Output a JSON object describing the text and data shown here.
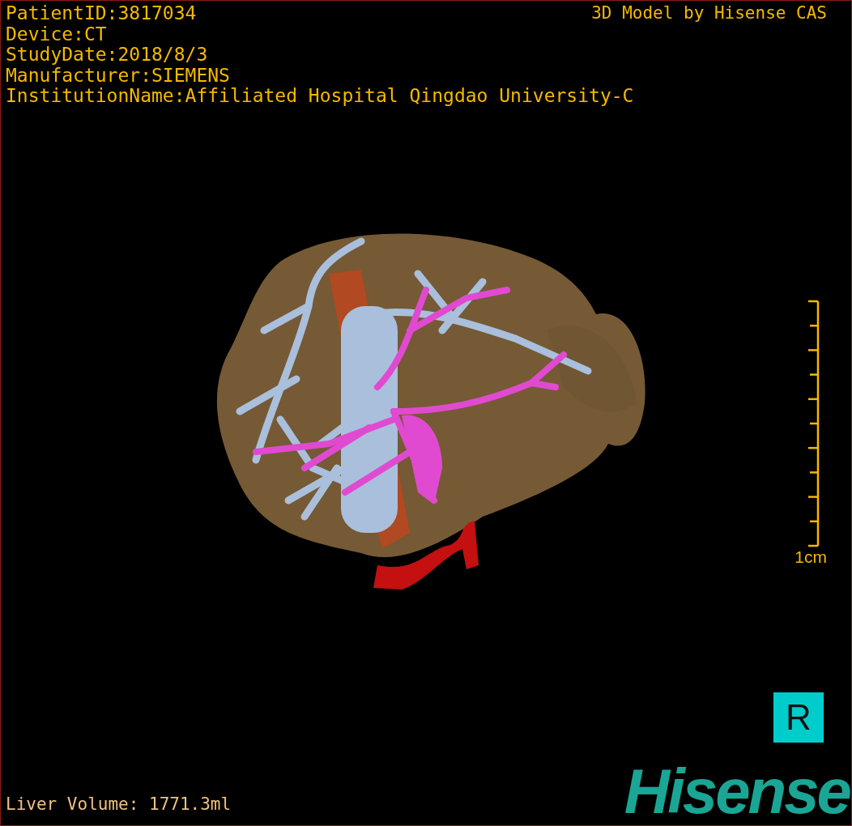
{
  "overlay_info": [
    "PatientID:3817034",
    "Device:CT",
    "StudyDate:2018/8/3",
    "Manufacturer:SIEMENS",
    "InstitutionName:Affiliated Hospital Qingdao University-C"
  ],
  "model_caption": "3D Model by Hisense CAS",
  "scale_bar": {
    "label": "1cm"
  },
  "orientation_marker": "R",
  "liver_volume": "Liver Volume: 1771.3ml",
  "logo": "Hisense"
}
